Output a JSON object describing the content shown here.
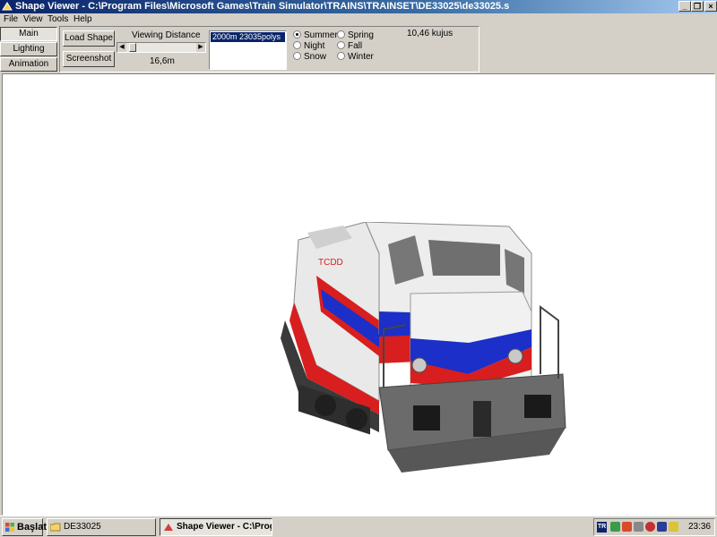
{
  "window": {
    "title": "Shape Viewer - C:\\Program Files\\Microsoft Games\\Train Simulator\\TRAINS\\TRAINSET\\DE33025\\de33025.s",
    "minimize": "_",
    "maximize": "❐",
    "close": "×"
  },
  "menu": [
    "File",
    "View",
    "Tools",
    "Help"
  ],
  "tabs": [
    {
      "label": "Main",
      "active": true
    },
    {
      "label": "Lighting",
      "active": false
    },
    {
      "label": "Animation",
      "active": false
    }
  ],
  "buttons": {
    "load_shape": "Load Shape",
    "screenshot": "Screenshot"
  },
  "viewing_distance": {
    "label": "Viewing Distance",
    "value": "16,6m"
  },
  "lod_list": {
    "selected": "2000m 23035polys"
  },
  "seasons": [
    {
      "label": "Summer",
      "selected": true
    },
    {
      "label": "Night",
      "selected": false
    },
    {
      "label": "Snow",
      "selected": false
    },
    {
      "label": "Spring",
      "selected": false
    },
    {
      "label": "Fall",
      "selected": false
    },
    {
      "label": "Winter",
      "selected": false
    }
  ],
  "vertex_count": "10,46 kujus",
  "taskbar": {
    "start": "Başlat",
    "tasks": [
      {
        "label": "DE33025",
        "active": false
      },
      {
        "label": "Shape Viewer - C:\\Prog...",
        "active": true
      }
    ],
    "language": "TR",
    "clock": "23:36"
  },
  "colors": {
    "titlebar_start": "#0a246a",
    "loco_red": "#d81e1e",
    "loco_blue": "#1c2fc8",
    "loco_body": "#e9e9e9"
  }
}
